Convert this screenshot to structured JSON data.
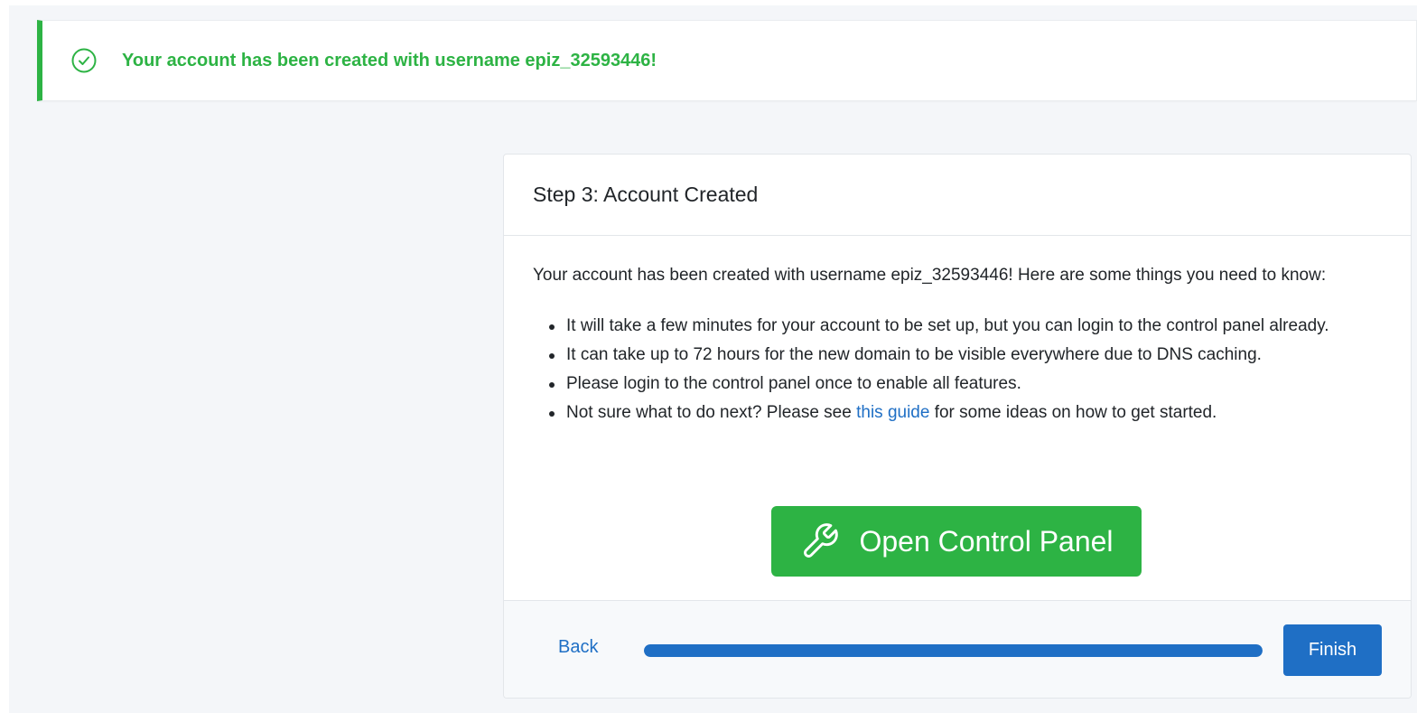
{
  "alert": {
    "icon": "check-circle-icon",
    "message": "Your account has been created with username epiz_32593446!",
    "color": "#2db344"
  },
  "card": {
    "title": "Step 3: Account Created",
    "intro": "Your account has been created with username epiz_32593446! Here are some things you need to know:",
    "items": [
      {
        "text": "It will take a few minutes for your account to be set up, but you can login to the control panel already."
      },
      {
        "text": "It can take up to 72 hours for the new domain to be visible everywhere due to DNS caching."
      },
      {
        "text": "Please login to the control panel once to enable all features."
      },
      {
        "before": "Not sure what to do next? Please see ",
        "link": "this guide",
        "after": " for some ideas on how to get started."
      }
    ],
    "control_panel_button": {
      "label": "Open Control Panel",
      "icon": "wrench-icon"
    }
  },
  "footer": {
    "back_label": "Back",
    "progress_percent": 100,
    "finish_label": "Finish"
  },
  "colors": {
    "success": "#2db344",
    "primary": "#1f6fc5",
    "background": "#f4f6f9"
  }
}
